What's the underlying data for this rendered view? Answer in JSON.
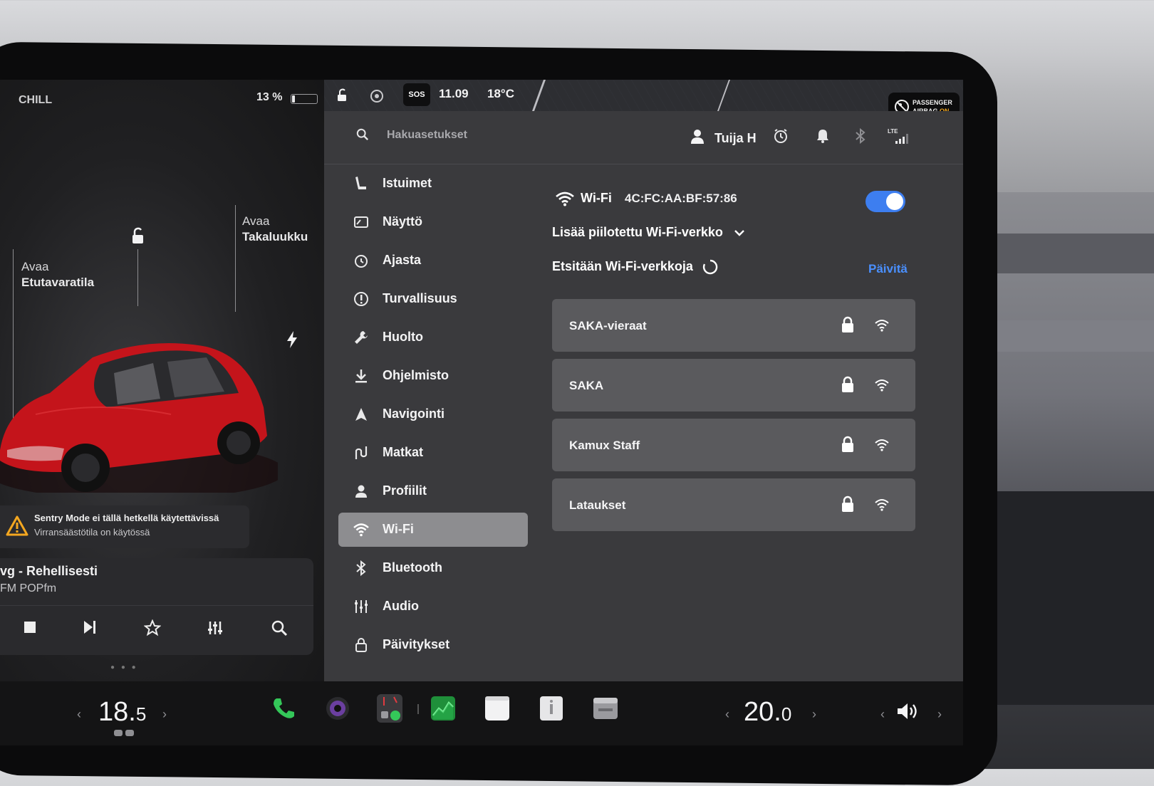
{
  "left_panel": {
    "drive_mode": "CHILL",
    "battery_percent": "13 %",
    "battery_level": 0.13,
    "front_trunk_label_1": "Avaa",
    "front_trunk_label_2": "Etutavaratila",
    "rear_trunk_label_1": "Avaa",
    "rear_trunk_label_2": "Takaluukku",
    "sentry_title": "Sentry Mode ei tällä hetkellä käytettävissä",
    "sentry_subtitle": "Virransäästötila on käytössä",
    "media_song": "vg - Rehellisesti",
    "media_station": "FM POPfm"
  },
  "status_bar": {
    "sos_label": "SOS",
    "time": "11.09",
    "temperature": "18°C",
    "airbag_line1": "PASSENGER",
    "airbag_line2": "AIRBAG",
    "airbag_state": "ON"
  },
  "settings": {
    "search_placeholder": "Hakuasetukset",
    "user_name": "Tuija H",
    "lte_label": "LTE",
    "menu": [
      {
        "label": "Istuimet",
        "icon": "seat-icon"
      },
      {
        "label": "Näyttö",
        "icon": "display-icon"
      },
      {
        "label": "Ajasta",
        "icon": "schedule-icon"
      },
      {
        "label": "Turvallisuus",
        "icon": "safety-icon"
      },
      {
        "label": "Huolto",
        "icon": "wrench-icon"
      },
      {
        "label": "Ohjelmisto",
        "icon": "download-icon"
      },
      {
        "label": "Navigointi",
        "icon": "navigation-icon"
      },
      {
        "label": "Matkat",
        "icon": "trips-icon"
      },
      {
        "label": "Profiilit",
        "icon": "profile-icon"
      },
      {
        "label": "Wi-Fi",
        "icon": "wifi-icon"
      },
      {
        "label": "Bluetooth",
        "icon": "bluetooth-icon"
      },
      {
        "label": "Audio",
        "icon": "audio-icon"
      },
      {
        "label": "Päivitykset",
        "icon": "updates-icon"
      }
    ],
    "active_menu": "Wi-Fi",
    "wifi": {
      "title": "Wi-Fi",
      "mac": "4C:FC:AA:BF:57:86",
      "enabled": true,
      "add_hidden": "Lisää piilotettu Wi-Fi-verkko",
      "scanning": "Etsitään Wi-Fi-verkkoja",
      "refresh": "Päivitä",
      "networks": [
        {
          "name": "SAKA-vieraat"
        },
        {
          "name": "SAKA"
        },
        {
          "name": "Kamux Staff"
        },
        {
          "name": "Lataukset"
        }
      ]
    }
  },
  "dock": {
    "left_temp_int": "18.",
    "left_temp_dec": "5",
    "right_temp_int": "20.",
    "right_temp_dec": "0"
  },
  "colors": {
    "accent_blue": "#3d7ef0",
    "link_blue": "#4a90ff",
    "car_red": "#c4141b",
    "airbag_orange": "#f4a720"
  }
}
